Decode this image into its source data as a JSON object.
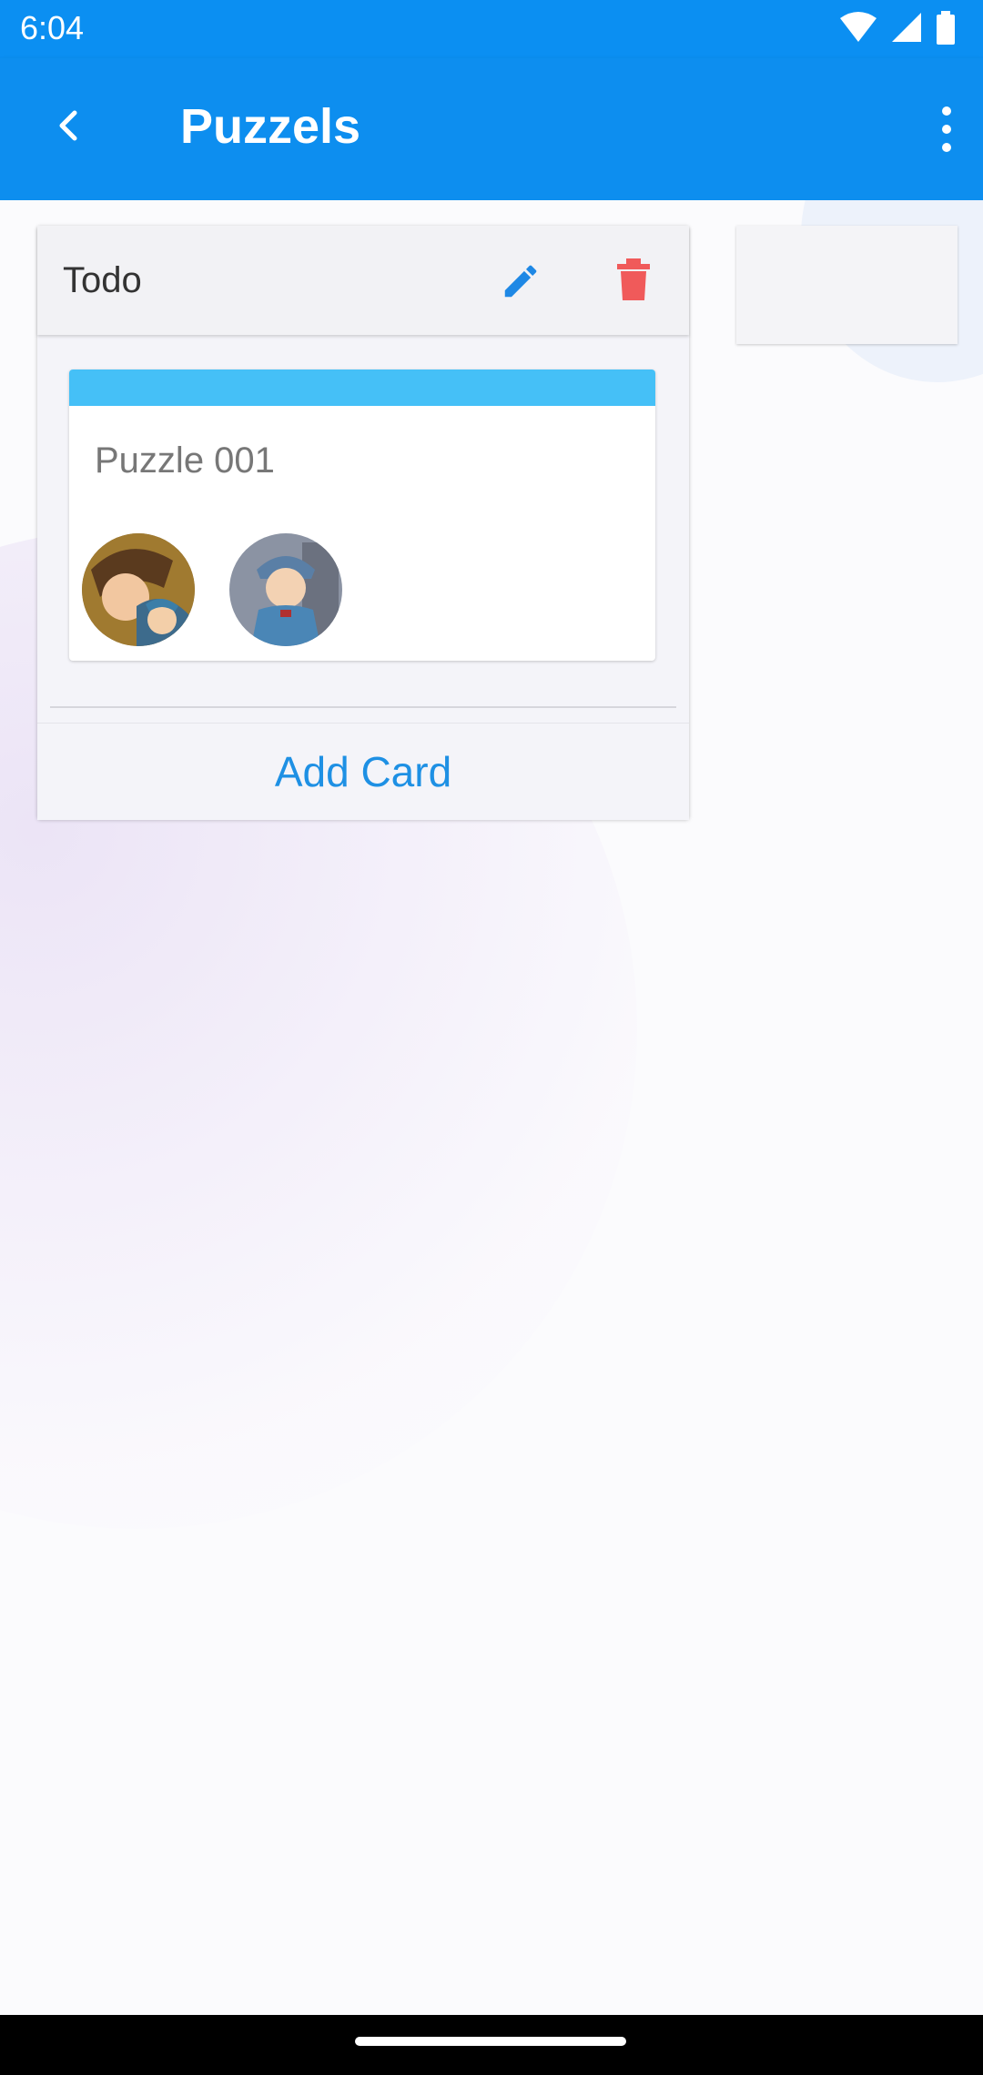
{
  "status_bar": {
    "time": "6:04",
    "icons": [
      "wifi-icon",
      "signal-icon",
      "battery-icon"
    ]
  },
  "app_bar": {
    "title": "Puzzels",
    "back_icon": "chevron-left-icon",
    "menu_icon": "more-vert-icon"
  },
  "board": {
    "columns": [
      {
        "title": "Todo",
        "edit_icon": "pencil-icon",
        "delete_icon": "trash-icon",
        "cards": [
          {
            "title": "Puzzle 001",
            "accent_color": "#45c0f7",
            "avatars": [
              "avatar-professor-and-apprentice",
              "avatar-boy-blue-cap"
            ]
          }
        ],
        "add_card_label": "Add Card"
      }
    ]
  },
  "colors": {
    "primary": "#0d8eef",
    "delete_red": "#f05a5a",
    "add_card_text": "#1e90e4",
    "card_accent": "#45c0f7"
  }
}
